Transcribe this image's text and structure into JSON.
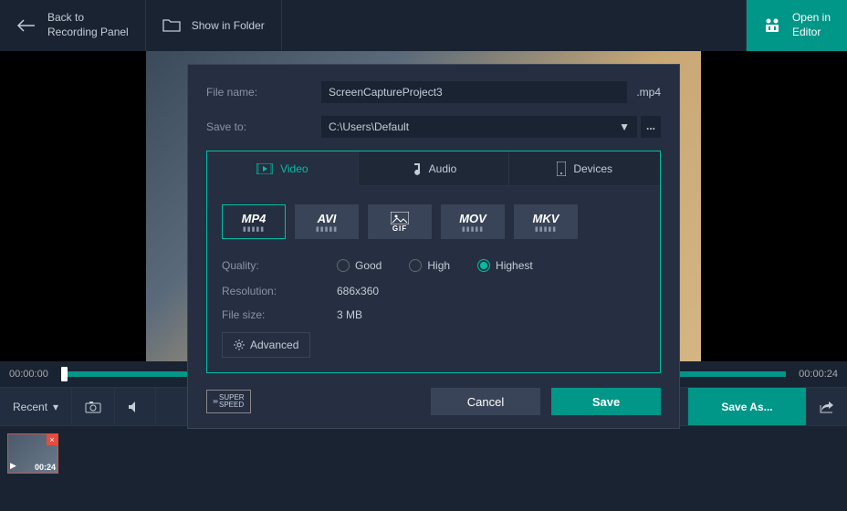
{
  "toolbar": {
    "back": "Back to\nRecording Panel",
    "folder": "Show in Folder",
    "editor": "Open in\nEditor"
  },
  "modal": {
    "file_name_label": "File name:",
    "file_name": "ScreenCaptureProject3",
    "ext": ".mp4",
    "save_to_label": "Save to:",
    "save_to": "C:\\Users\\Default",
    "tabs": {
      "video": "Video",
      "audio": "Audio",
      "devices": "Devices"
    },
    "formats": [
      "MP4",
      "AVI",
      "GIF",
      "MOV",
      "MKV"
    ],
    "quality_label": "Quality:",
    "quality": {
      "good": "Good",
      "high": "High",
      "highest": "Highest"
    },
    "resolution_label": "Resolution:",
    "resolution": "686x360",
    "filesize_label": "File size:",
    "filesize": "3 MB",
    "advanced": "Advanced",
    "cancel": "Cancel",
    "save": "Save",
    "super": "SUPER\nSPEED"
  },
  "timeline": {
    "start": "00:00:00",
    "end": "00:00:24"
  },
  "bottombar": {
    "recent": "Recent",
    "saveas": "Save As..."
  },
  "thumb": {
    "duration": "00:24"
  }
}
